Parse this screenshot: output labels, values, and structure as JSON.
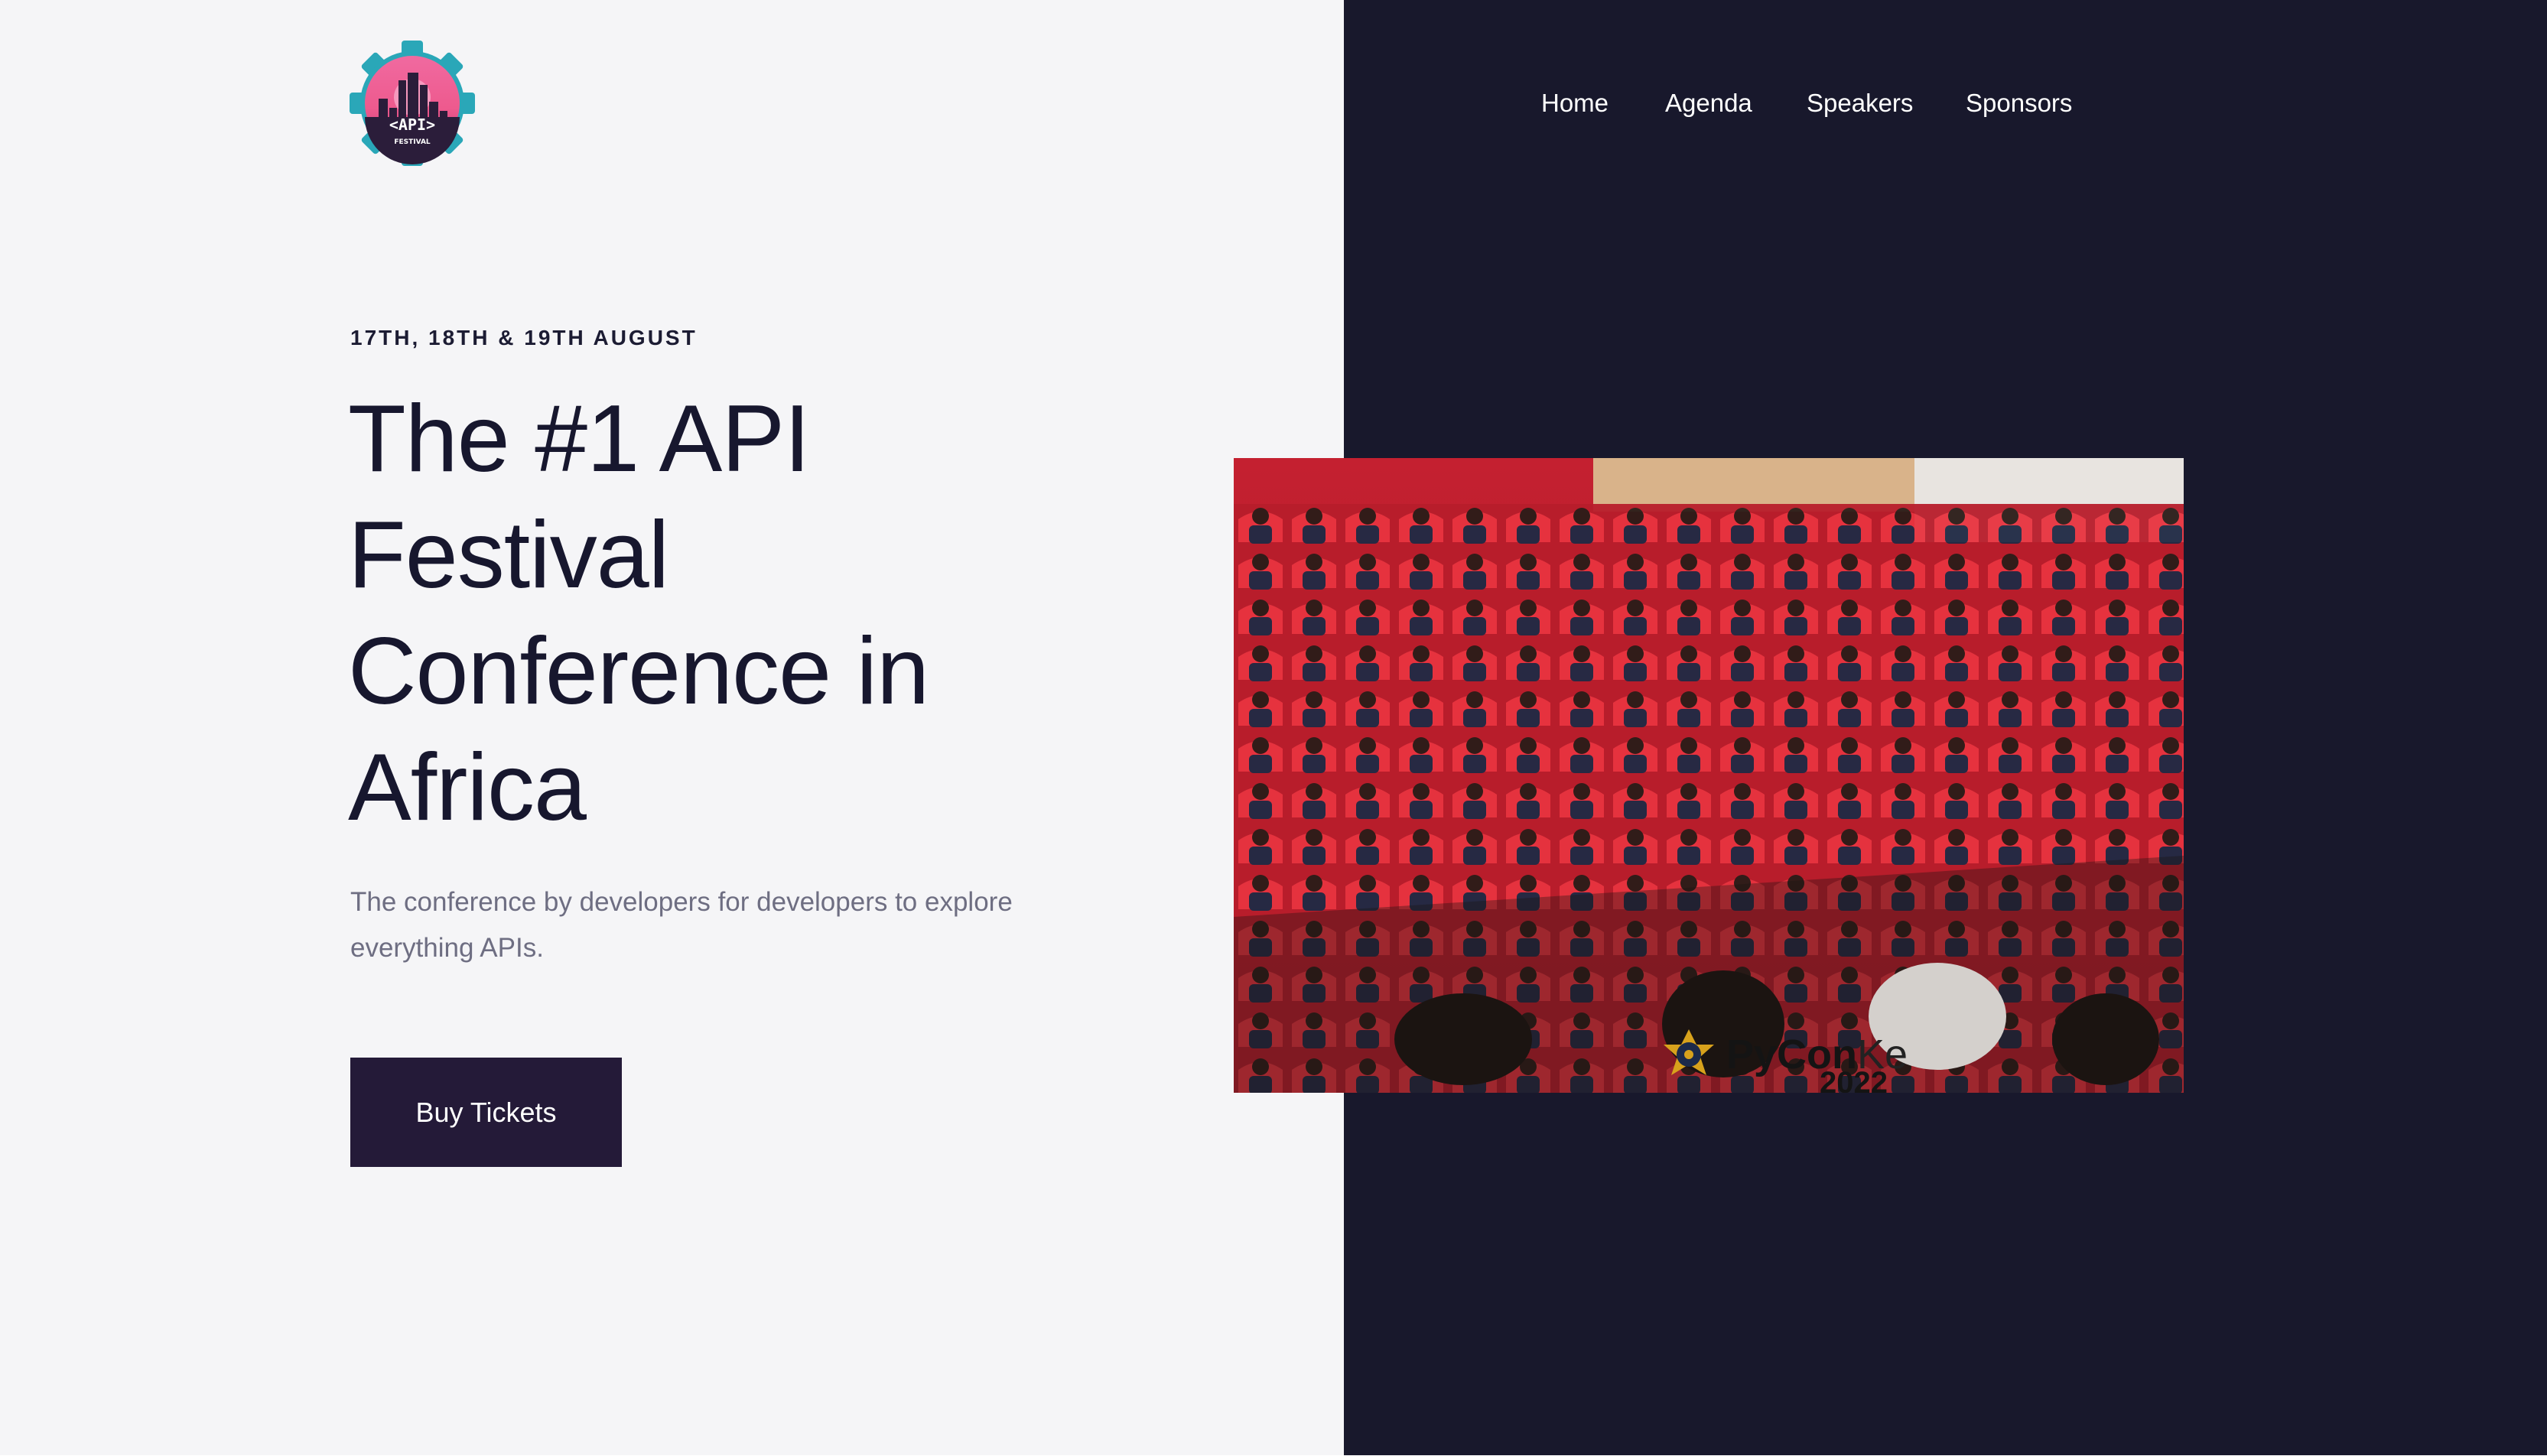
{
  "logo": {
    "text": "<API>",
    "subtext": "FESTIVAL",
    "icon": "api-festival-gear-logo"
  },
  "nav": {
    "items": [
      "Home",
      "Agenda",
      "Speakers",
      "Sponsors"
    ]
  },
  "hero": {
    "eyebrow": "17TH, 18TH & 19TH AUGUST",
    "headline": [
      "The #1 API",
      "Festival",
      "Conference in",
      "Africa"
    ],
    "subtext": "The conference by developers for developers to explore everything APIs.",
    "cta_label": "Buy Tickets"
  },
  "photo": {
    "description_icon": "conference-audience-photo",
    "caption_brand": "PyCon",
    "caption_brand_light": "Ke",
    "caption_year": "2022"
  },
  "colors": {
    "left_bg": "#f5f5f7",
    "right_bg": "#18182c",
    "headline": "#17172e",
    "subtext": "#6e6e82",
    "button_bg": "#241a38"
  }
}
